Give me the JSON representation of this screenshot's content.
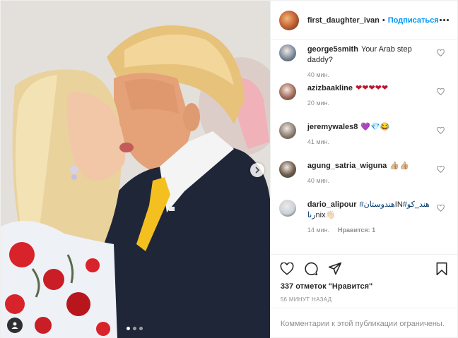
{
  "post": {
    "author": "first_daughter_ivan",
    "separator": "•",
    "follow_label": "Подписаться",
    "likes_text": "337 отметок \"Нравится\"",
    "timestamp": "56 МИНУТ НАЗАД",
    "comments_restricted": "Комментарии к этой публикации ограничены."
  },
  "carousel": {
    "dots": 3,
    "active_dot": 1
  },
  "comments": [
    {
      "user": "george5smith",
      "text": "Your Arab step daddy?",
      "time": "40 мин.",
      "likes": "",
      "avatar_color": "#7a8a9c"
    },
    {
      "user": "azizbaakline",
      "text": "❤❤❤❤❤",
      "time": "20 мин.",
      "likes": "",
      "avatar_color": "#a36b5a"
    },
    {
      "user": "jeremywales8",
      "text": "💜💎😂",
      "time": "41 мин.",
      "likes": "",
      "avatar_color": "#8c7f73"
    },
    {
      "user": "agung_satria_wiguna",
      "text": "👍🏼👍🏼",
      "time": "40 мин.",
      "likes": "",
      "avatar_color": "#6b5a4a"
    },
    {
      "user": "dario_alipour",
      "text_parts": [
        "#هندوستان",
        "IN",
        "#هند_كورنا",
        "nix👋🏻"
      ],
      "time": "14 мин.",
      "likes": "Нравится: 1",
      "avatar_color": "#c9d2dc"
    }
  ],
  "colors": {
    "link": "#0095f6",
    "hashtag": "#00376b",
    "muted": "#8e8e8e",
    "text": "#262626",
    "heart_red": "#c0142c"
  }
}
